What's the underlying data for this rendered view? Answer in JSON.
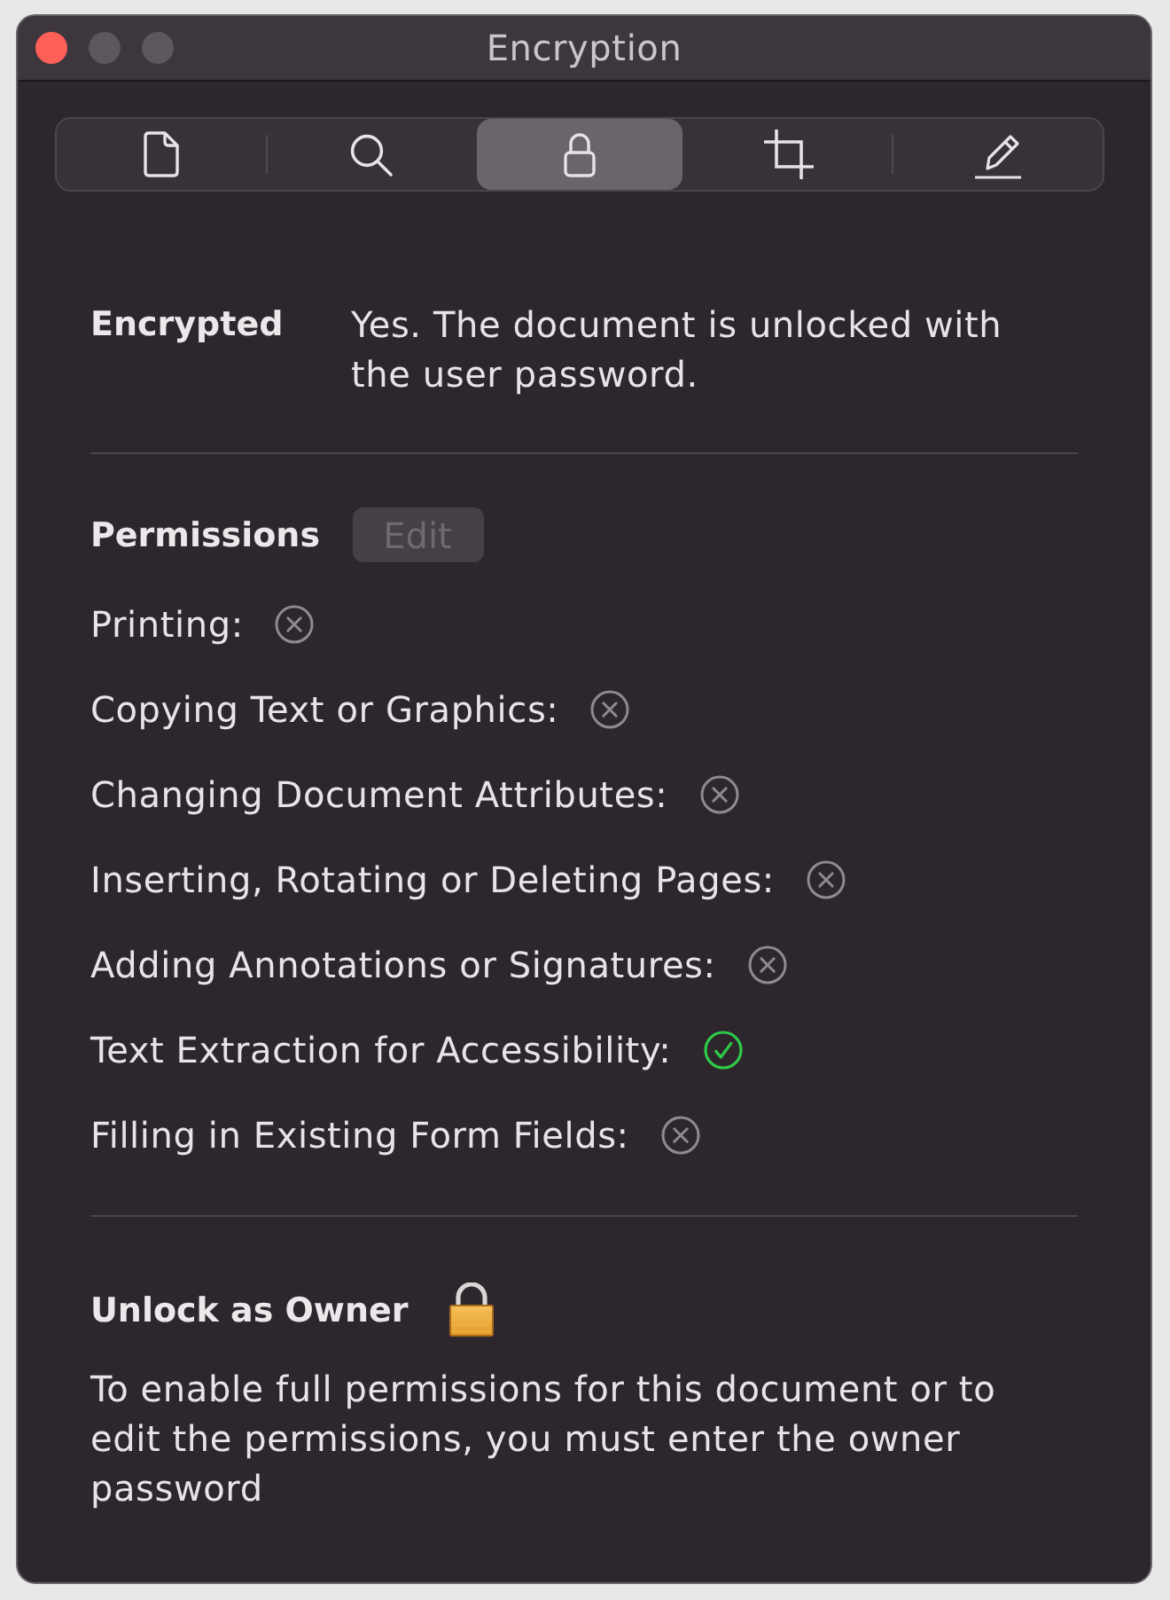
{
  "window": {
    "title": "Encryption",
    "controls": [
      {
        "kind": "close",
        "disabled": false
      },
      {
        "kind": "minimize",
        "disabled": true
      },
      {
        "kind": "zoom",
        "disabled": true
      }
    ]
  },
  "toolbar": {
    "tabs": [
      {
        "kind": "document",
        "selected": false
      },
      {
        "kind": "search",
        "selected": false
      },
      {
        "kind": "lock",
        "selected": true
      },
      {
        "kind": "crop",
        "selected": false
      },
      {
        "kind": "markup",
        "selected": false
      }
    ]
  },
  "encryption": {
    "label": "Encrypted",
    "value": "Yes. The document is unlocked with the user password."
  },
  "permissions": {
    "title": "Permissions",
    "edit_button": {
      "label": "Edit",
      "disabled": true
    },
    "items": [
      {
        "label": "Printing:",
        "allowed": false
      },
      {
        "label": "Copying Text or Graphics:",
        "allowed": false
      },
      {
        "label": "Changing Document Attributes:",
        "allowed": false
      },
      {
        "label": "Inserting, Rotating or Deleting Pages:",
        "allowed": false
      },
      {
        "label": "Adding Annotations or Signatures:",
        "allowed": false
      },
      {
        "label": "Text Extraction for Accessibility:",
        "allowed": true
      },
      {
        "label": "Filling in Existing Form Fields:",
        "allowed": false
      }
    ]
  },
  "unlock": {
    "title": "Unlock as Owner",
    "message": "To enable full permissions for this document or to edit the permissions, you must enter the owner password"
  }
}
